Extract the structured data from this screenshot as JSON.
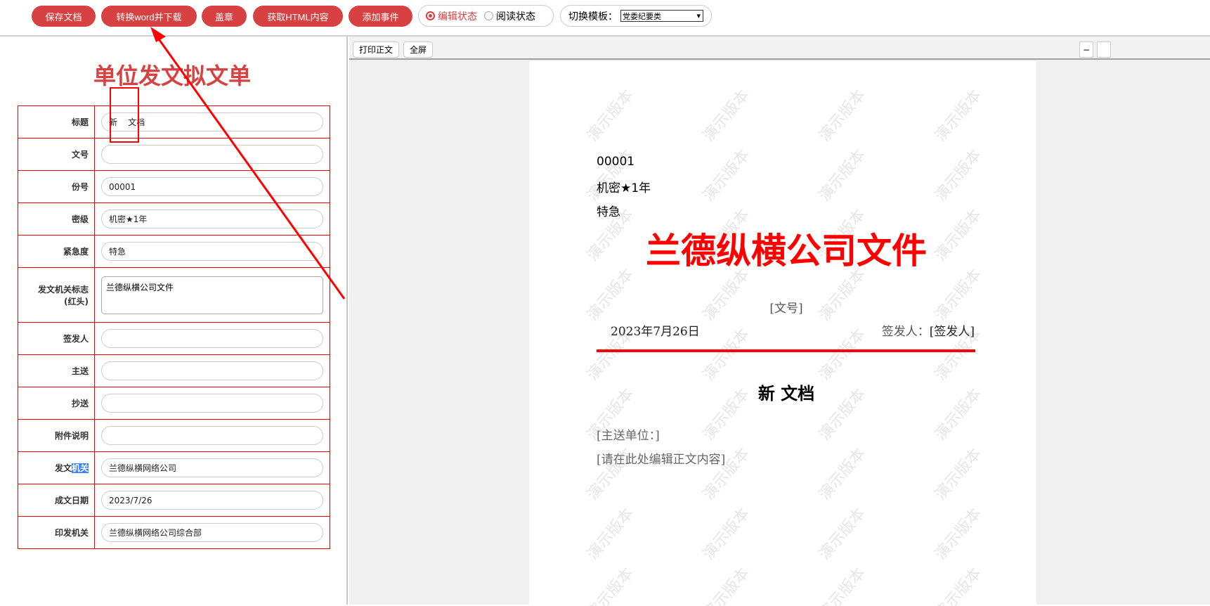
{
  "toolbar": {
    "save": "保存文档",
    "convert_word": "转换word并下载",
    "stamp": "盖章",
    "get_html": "获取HTML内容",
    "add_event": "添加事件",
    "mode_edit": "编辑状态",
    "mode_read": "阅读状态",
    "template_label": "切换模板：",
    "template_value": "党委纪要类"
  },
  "form": {
    "title": "单位发文拟文单",
    "rows": [
      {
        "label": "标题",
        "value": "新    文档"
      },
      {
        "label": "文号",
        "value": ""
      },
      {
        "label": "份号",
        "value": "00001"
      },
      {
        "label": "密级",
        "value": "机密★1年"
      },
      {
        "label": "紧急度",
        "value": "特急"
      },
      {
        "label": "发文机关标志\n(红头)",
        "value": "兰德纵横公司文件"
      },
      {
        "label": "签发人",
        "value": ""
      },
      {
        "label": "主送",
        "value": ""
      },
      {
        "label": "抄送",
        "value": ""
      },
      {
        "label": "附件说明",
        "value": ""
      },
      {
        "label": "发文机关",
        "value": "兰德纵横网络公司"
      },
      {
        "label": "成文日期",
        "value": "2023/7/26"
      },
      {
        "label": "印发机关",
        "value": "兰德纵横网络公司综合部"
      }
    ]
  },
  "preview": {
    "print": "打印正文",
    "fullscreen": "全屏",
    "minimize": "−",
    "watermark": "演示版本",
    "copy_no": "00001",
    "secret": "机密★1年",
    "urgency": "特急",
    "red_head": "兰德纵横公司文件",
    "doc_no": "[文号]",
    "date": "2023年7月26日",
    "signer_label": "签发人：",
    "signer": "[签发人]",
    "doc_title": "新 文档",
    "recipient": "[主送单位：]",
    "body": "[请在此处编辑正文内容]"
  },
  "colors": {
    "accent": "#d84141",
    "red": "#ff0000"
  }
}
